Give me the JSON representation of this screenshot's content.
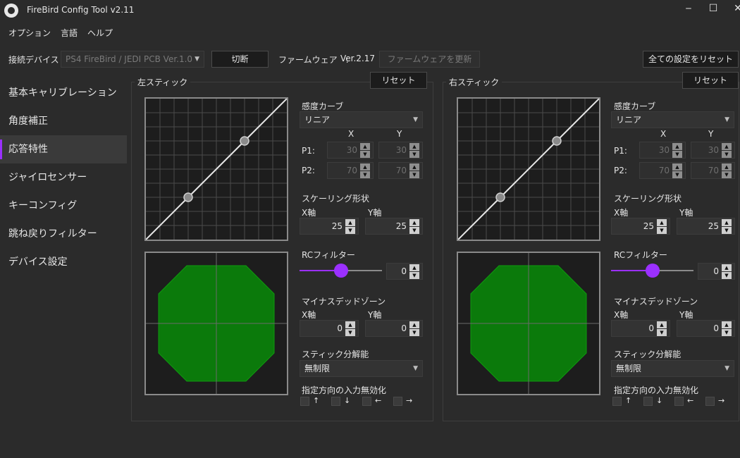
{
  "window": {
    "title": "FireBird Config Tool v2.11",
    "minimize": "‒",
    "maximize": "☐",
    "close": "✕"
  },
  "menu": [
    "オプション",
    "言語",
    "ヘルプ"
  ],
  "toolbar": {
    "device_label": "接続デバイス",
    "device_value": "PS4 FireBird / JEDI PCB Ver.1.0",
    "disconnect": "切断",
    "firmware_label": "ファームウェア　:",
    "firmware_version": "Ver.2.17",
    "update_firmware": "ファームウェアを更新",
    "reset_all": "全ての設定をリセット"
  },
  "sidebar": {
    "items": [
      "基本キャリブレーション",
      "角度補正",
      "応答特性",
      "ジャイロセンサー",
      "キーコンフィグ",
      "跳ね戻りフィルター",
      "デバイス設定"
    ],
    "active_index": 2
  },
  "accent_color": "#9b30ff",
  "deadzone_color": "#0b7a0b",
  "common": {
    "reset": "リセット",
    "curve_label": "感度カーブ",
    "curve_value": "リニア",
    "col_x": "X",
    "col_y": "Y",
    "p1": "P1:",
    "p2": "P2:",
    "scaling_label": "スケーリング形状",
    "x_axis": "X軸",
    "y_axis": "Y軸",
    "rc_label": "RCフィルター",
    "minus_dz_label": "マイナスデッドゾーン",
    "resolution_label": "スティック分解能",
    "resolution_value": "無制限",
    "disable_dir_label": "指定方向の入力無効化",
    "dir_up": "↑",
    "dir_down": "↓",
    "dir_left": "←",
    "dir_right": "→"
  },
  "left": {
    "title": "左スティック",
    "p1_x": "30",
    "p1_y": "30",
    "p2_x": "70",
    "p2_y": "70",
    "scale_x": "25",
    "scale_y": "25",
    "rc_value": "0",
    "rc_level": 0.5,
    "dz_x": "0",
    "dz_y": "0"
  },
  "right": {
    "title": "右スティック",
    "p1_x": "30",
    "p1_y": "30",
    "p2_x": "70",
    "p2_y": "70",
    "scale_x": "25",
    "scale_y": "25",
    "rc_value": "0",
    "rc_level": 0.5,
    "dz_x": "0",
    "dz_y": "0"
  }
}
